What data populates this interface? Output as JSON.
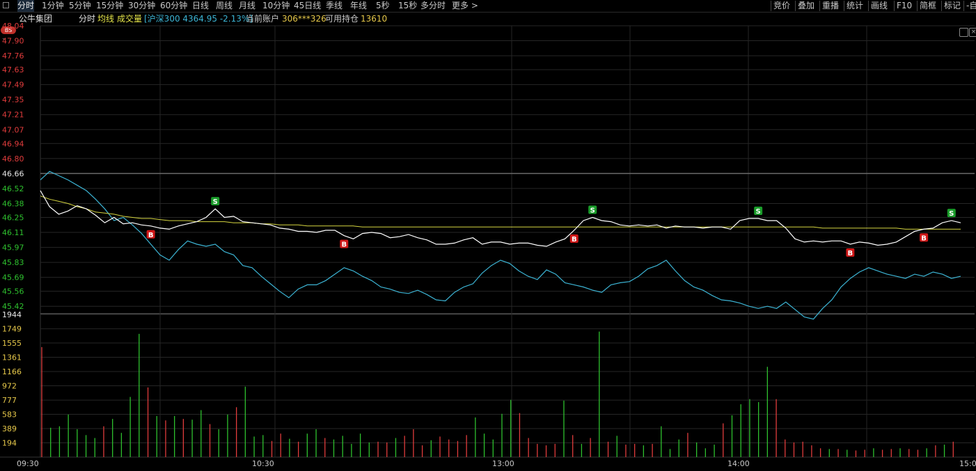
{
  "toolbar": {
    "periods": [
      "分时",
      "1分钟",
      "5分钟",
      "15分钟",
      "30分钟",
      "60分钟",
      "日线",
      "周线",
      "月线",
      "10分钟",
      "45日线",
      "季线",
      "年线",
      "5秒",
      "15秒",
      "多分时",
      "更多 >"
    ],
    "active_period": "分时",
    "right_tools": [
      "竞价",
      "叠加",
      "重播",
      "统计",
      "画线",
      "F10",
      "简框",
      "标记",
      "-自"
    ]
  },
  "info": {
    "stock_name": "公牛集团",
    "mode": "分时",
    "avg_label": "均线",
    "vol_label": "成交量",
    "index_text": "[沪深300 4364.95 -2.13%]",
    "account_label": "当前账户",
    "account_value": "306***326",
    "position_label": "可用持仓",
    "position_value": "13610",
    "bs_badge": "BS"
  },
  "colors": {
    "up": "#e03c3c",
    "down": "#2ec02e",
    "price_line": "#ffffff",
    "avg_line": "#d6d640",
    "index_line": "#3cb4d4",
    "grid": "#262626",
    "buy_marker": "#d01818",
    "sell_marker": "#1a9c2a"
  },
  "chart_data": {
    "type": "line",
    "price_axis": {
      "ticks_up": [
        "48.04",
        "47.90",
        "47.76",
        "47.63",
        "47.49",
        "47.35",
        "47.21",
        "47.07",
        "46.94",
        "46.80"
      ],
      "prev_close": "46.66",
      "ticks_down": [
        "46.52",
        "46.38",
        "46.25",
        "46.11",
        "45.97",
        "45.83",
        "45.69",
        "45.56",
        "45.42"
      ],
      "ylim": [
        45.35,
        48.04
      ]
    },
    "volume_axis": {
      "ticks": [
        "1944",
        "1749",
        "1555",
        "1361",
        "1166",
        "972",
        "777",
        "583",
        "389",
        "194"
      ],
      "ylim": [
        0,
        1944
      ]
    },
    "time_labels": [
      "09:30",
      "10:30",
      "13:00",
      "14:00",
      "15:00"
    ],
    "series": [
      {
        "name": "公牛集团",
        "values": [
          46.5,
          46.35,
          46.28,
          46.31,
          46.36,
          46.33,
          46.27,
          46.2,
          46.25,
          46.19,
          46.2,
          46.18,
          46.17,
          46.15,
          46.14,
          46.17,
          46.19,
          46.21,
          46.25,
          46.33,
          46.25,
          46.26,
          46.21,
          46.2,
          46.19,
          46.18,
          46.15,
          46.14,
          46.12,
          46.12,
          46.11,
          46.13,
          46.13,
          46.08,
          46.05,
          46.1,
          46.11,
          46.1,
          46.06,
          46.07,
          46.09,
          46.06,
          46.04,
          46.0,
          46.0,
          46.01,
          46.04,
          46.06,
          46.0,
          46.02,
          46.02,
          46.0,
          46.01,
          46.01,
          45.99,
          45.98,
          46.02,
          46.05,
          46.13,
          46.22,
          46.25,
          46.22,
          46.21,
          46.18,
          46.17,
          46.18,
          46.17,
          46.18,
          46.15,
          46.17,
          46.16,
          46.16,
          46.15,
          46.16,
          46.16,
          46.14,
          46.22,
          46.24,
          46.24,
          46.22,
          46.22,
          46.15,
          46.05,
          46.02,
          46.03,
          46.02,
          46.03,
          46.03,
          46.0,
          46.02,
          46.01,
          45.99,
          46.0,
          46.02,
          46.07,
          46.12,
          46.14,
          46.15,
          46.2,
          46.22,
          46.2
        ]
      },
      {
        "name": "均线",
        "values": [
          46.45,
          46.42,
          46.4,
          46.38,
          46.35,
          46.33,
          46.3,
          46.29,
          46.28,
          46.26,
          46.25,
          46.24,
          46.24,
          46.23,
          46.22,
          46.22,
          46.22,
          46.21,
          46.21,
          46.21,
          46.21,
          46.2,
          46.2,
          46.2,
          46.19,
          46.19,
          46.18,
          46.18,
          46.18,
          46.17,
          46.17,
          46.17,
          46.17,
          46.17,
          46.17,
          46.16,
          46.16,
          46.16,
          46.16,
          46.16,
          46.16,
          46.16,
          46.16,
          46.16,
          46.16,
          46.16,
          46.16,
          46.16,
          46.16,
          46.16,
          46.16,
          46.16,
          46.16,
          46.16,
          46.16,
          46.16,
          46.16,
          46.16,
          46.16,
          46.16,
          46.16,
          46.16,
          46.16,
          46.16,
          46.16,
          46.16,
          46.16,
          46.16,
          46.16,
          46.16,
          46.16,
          46.16,
          46.16,
          46.16,
          46.16,
          46.16,
          46.16,
          46.16,
          46.16,
          46.16,
          46.16,
          46.16,
          46.16,
          46.16,
          46.16,
          46.15,
          46.15,
          46.15,
          46.15,
          46.15,
          46.15,
          46.15,
          46.15,
          46.15,
          46.14,
          46.14,
          46.14,
          46.14,
          46.14,
          46.14,
          46.14
        ]
      },
      {
        "name": "沪深300",
        "values": [
          46.6,
          46.68,
          46.64,
          46.6,
          46.55,
          46.5,
          46.42,
          46.33,
          46.22,
          46.25,
          46.18,
          46.1,
          46.0,
          45.9,
          45.85,
          45.95,
          46.03,
          46.0,
          45.98,
          46.0,
          45.93,
          45.9,
          45.8,
          45.78,
          45.7,
          45.63,
          45.56,
          45.5,
          45.58,
          45.62,
          45.62,
          45.66,
          45.72,
          45.78,
          45.75,
          45.7,
          45.66,
          45.6,
          45.58,
          45.55,
          45.54,
          45.57,
          45.53,
          45.48,
          45.47,
          45.55,
          45.6,
          45.63,
          45.73,
          45.8,
          45.85,
          45.82,
          45.75,
          45.7,
          45.67,
          45.76,
          45.72,
          45.64,
          45.62,
          45.6,
          45.57,
          45.55,
          45.62,
          45.64,
          45.65,
          45.7,
          45.77,
          45.8,
          45.85,
          45.75,
          45.66,
          45.6,
          45.57,
          45.52,
          45.48,
          45.47,
          45.45,
          45.42,
          45.4,
          45.42,
          45.4,
          45.46,
          45.39,
          45.32,
          45.3,
          45.4,
          45.48,
          45.6,
          45.68,
          45.74,
          45.78,
          45.75,
          45.72,
          45.7,
          45.68,
          45.72,
          45.7,
          45.74,
          45.72,
          45.68,
          45.7
        ]
      }
    ],
    "markers": [
      {
        "type": "B",
        "index": 12
      },
      {
        "type": "S",
        "index": 19
      },
      {
        "type": "B",
        "index": 33
      },
      {
        "type": "B",
        "index": 58
      },
      {
        "type": "S",
        "index": 60
      },
      {
        "type": "S",
        "index": 78
      },
      {
        "type": "B",
        "index": 88
      },
      {
        "type": "B",
        "index": 96
      },
      {
        "type": "S",
        "index": 99
      }
    ],
    "volume": {
      "values": [
        1500,
        400,
        420,
        580,
        380,
        300,
        260,
        420,
        520,
        330,
        820,
        1680,
        950,
        560,
        500,
        560,
        520,
        510,
        640,
        450,
        380,
        580,
        680,
        960,
        280,
        300,
        220,
        320,
        250,
        210,
        320,
        380,
        260,
        240,
        290,
        180,
        320,
        200,
        210,
        200,
        260,
        290,
        380,
        160,
        230,
        280,
        240,
        220,
        300,
        540,
        320,
        240,
        590,
        780,
        600,
        260,
        180,
        160,
        180,
        770,
        300,
        180,
        260,
        1710,
        210,
        290,
        170,
        180,
        160,
        180,
        420,
        110,
        240,
        330,
        200,
        120,
        170,
        460,
        570,
        720,
        790,
        750,
        1230,
        790,
        240,
        200,
        210,
        160,
        120,
        110,
        110,
        100,
        90,
        100,
        120,
        100,
        110,
        120,
        110,
        100,
        120,
        160,
        170,
        210
      ],
      "colors": [
        "up",
        "down",
        "down",
        "down",
        "down",
        "down",
        "down",
        "up",
        "down",
        "down",
        "down",
        "down",
        "up",
        "down",
        "up",
        "down",
        "up",
        "down",
        "down",
        "up",
        "down",
        "down",
        "up",
        "down",
        "down",
        "down",
        "up",
        "up",
        "down",
        "up",
        "down",
        "down",
        "up",
        "down",
        "down",
        "down",
        "down",
        "down",
        "up",
        "up",
        "down",
        "up",
        "up",
        "up",
        "down",
        "up",
        "up",
        "up",
        "up",
        "down",
        "down",
        "down",
        "down",
        "down",
        "up",
        "up",
        "up",
        "up",
        "up",
        "down",
        "up",
        "down",
        "up",
        "down",
        "up",
        "down",
        "up",
        "up",
        "down",
        "up",
        "down",
        "down",
        "down",
        "up",
        "down",
        "down",
        "down",
        "up",
        "down",
        "down",
        "down",
        "down",
        "down",
        "up",
        "up",
        "up",
        "up",
        "up",
        "up",
        "down",
        "up",
        "down",
        "up",
        "up",
        "down",
        "up",
        "up",
        "down",
        "up",
        "up",
        "down",
        "up",
        "down",
        "up"
      ]
    }
  }
}
